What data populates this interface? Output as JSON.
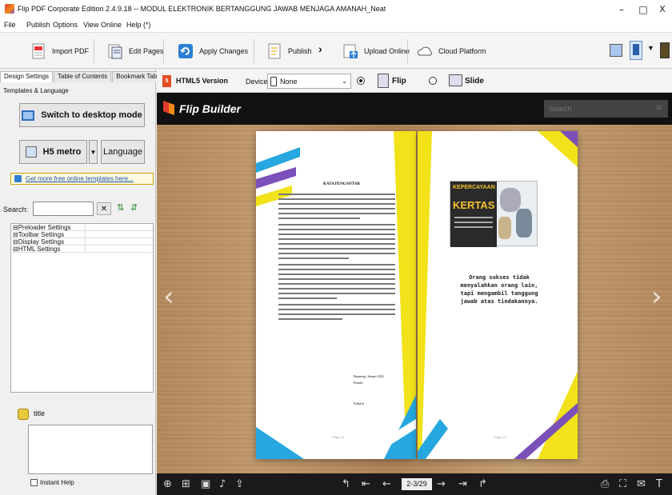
{
  "window": {
    "title": "Flip PDF Corporate Edition 2.4.9.18 -- MODUL ELEKTRONIK BERTANGGUNG JAWAB MENJAGA AMANAH_Neat",
    "controls": [
      "–",
      "□",
      "X"
    ]
  },
  "menu": [
    "File",
    "Publish",
    "Options",
    "View",
    "Online",
    "Help (*)"
  ],
  "toolbar": {
    "import_pdf": "Import PDF",
    "edit_pages": "Edit Pages",
    "apply_changes": "Apply Changes",
    "publish": "Publish",
    "upload_online": "Upload Online",
    "cloud_platform": "Cloud Platform"
  },
  "left_panel": {
    "tabs": [
      "Design Settings",
      "Table of Contents",
      "Bookmark Tabs"
    ],
    "group_label": "Templates & Language",
    "switch_desktop": "Switch to desktop mode",
    "template_name": "H5 metro",
    "language": "Language",
    "more_templates": "Get more free online templates here...",
    "search_label": "Search:",
    "search_value": "",
    "settings": [
      "⊟Preloader Settings",
      "⊟Toolbar Settings",
      "⊟Display Settings",
      "⊟HTML Settings"
    ],
    "title_label": "title",
    "instant_help": "Instant Help"
  },
  "preview_controls": {
    "html5_version": "HTML5 Version",
    "device_label": "Device:",
    "device_value": "None",
    "flip_label": "Flip",
    "slide_label": "Slide"
  },
  "viewer": {
    "brand": "Flip Builder",
    "search_placeholder": "Search",
    "left_page": {
      "heading": "KATA PENGANTAR",
      "closing_city": "Bantaeng, Januari 2022",
      "closing_role": "Penulis",
      "closing_name": "Zulkarli",
      "page_number": "Page 18"
    },
    "right_page": {
      "poster_title1": "KEPERCAYAAN",
      "poster_title2": "KERTAS",
      "quote": "Orang sukses tidak menyalahkan orang lain, tapi mengambil tanggung jawab atas tindakannya.",
      "page_number": "Page 19"
    },
    "page_indicator": "2-3/29"
  },
  "colors": {
    "accent_yellow": "#f1e21a",
    "accent_blue": "#27a7df",
    "accent_purple": "#7b50b8",
    "header_black": "#111111"
  }
}
